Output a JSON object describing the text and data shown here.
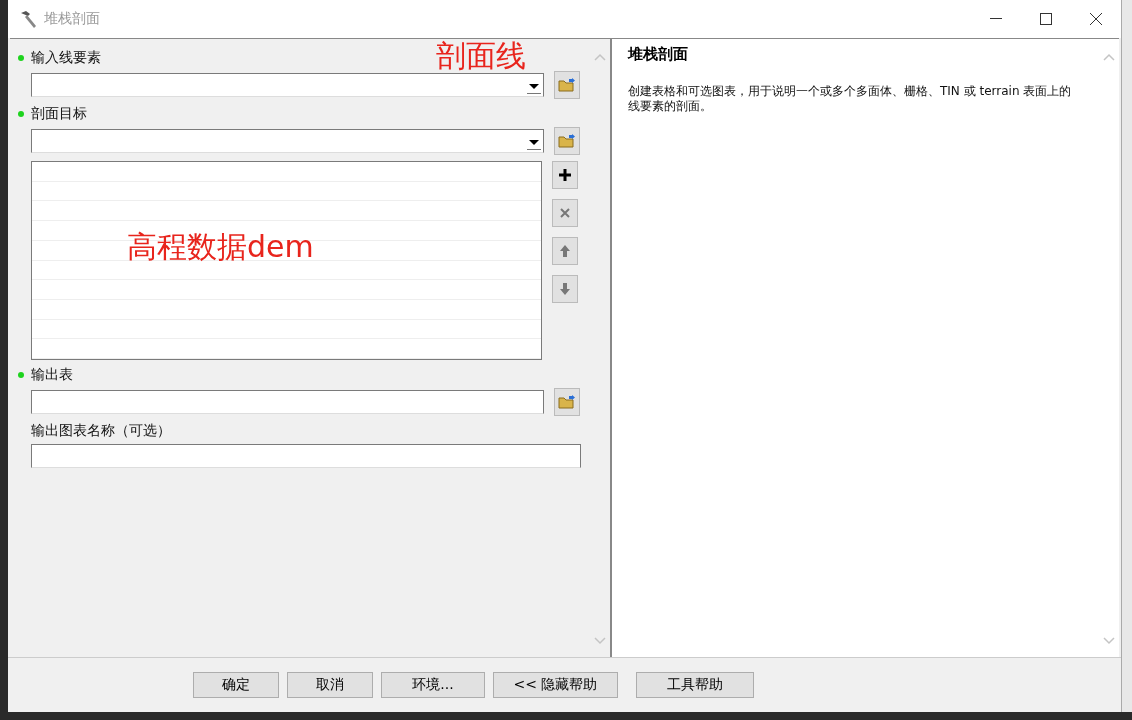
{
  "window": {
    "title": "堆栈剖面"
  },
  "parameters": [
    {
      "kind": "dropdown",
      "label": "输入线要素",
      "required": true,
      "browse": true,
      "annotation": "剖面线"
    },
    {
      "kind": "dropdown",
      "label": "剖面目标",
      "required": true,
      "browse": true
    },
    {
      "kind": "list",
      "annotation": "高程数据dem"
    },
    {
      "kind": "text",
      "label": "输出表",
      "required": true,
      "browse": true
    },
    {
      "kind": "text",
      "label": "输出图表名称（可选）",
      "required": false,
      "browse": false
    }
  ],
  "help": {
    "title": "堆栈剖面",
    "text": "创建表格和可选图表，用于说明一个或多个多面体、栅格、TIN 或  terrain 表面上的线要素的剖面。"
  },
  "buttons": [
    {
      "label": "确定"
    },
    {
      "label": "取消"
    },
    {
      "label": "环境..."
    },
    {
      "label": "<< 隐藏帮助"
    },
    {
      "label": "工具帮助"
    }
  ]
}
